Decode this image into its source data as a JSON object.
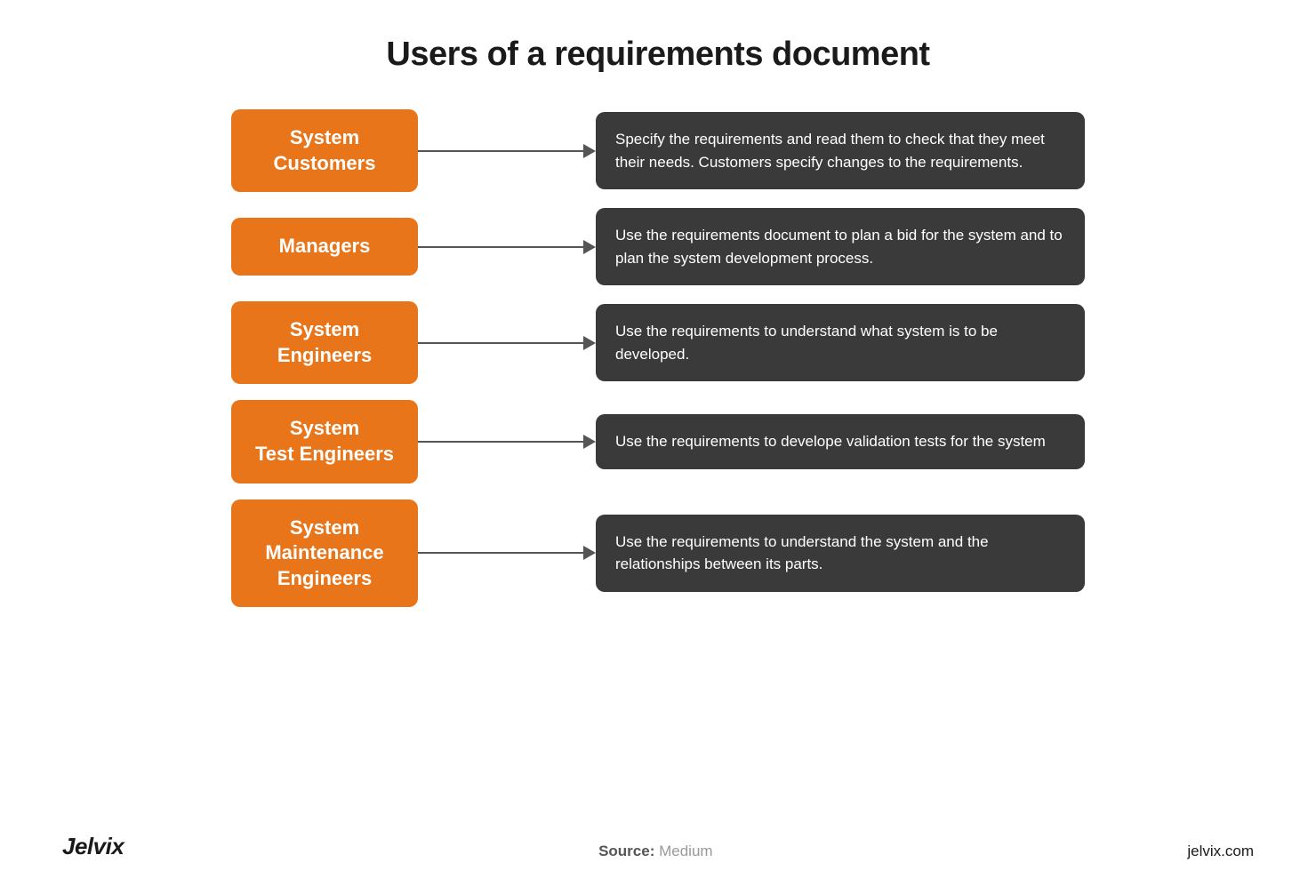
{
  "page": {
    "title": "Users of a requirements document",
    "background_color": "#ffffff"
  },
  "rows": [
    {
      "id": "system-customers",
      "label": "System\nCustomers",
      "description": "Specify the requirements and read them to check that they meet their needs. Customers specify changes to the requirements."
    },
    {
      "id": "managers",
      "label": "Managers",
      "description": "Use the requirements document to plan a bid for the system and to plan the system development process."
    },
    {
      "id": "system-engineers",
      "label": "System\nEngineers",
      "description": "Use the requirements to understand what system is to be developed."
    },
    {
      "id": "system-test-engineers",
      "label": "System\nTest Engineers",
      "description": "Use the requirements to develope validation tests for the system"
    },
    {
      "id": "system-maintenance-engineers",
      "label": "System\nMaintenance\nEngineers",
      "description": "Use the requirements to understand the system and the relationships between its parts."
    }
  ],
  "footer": {
    "brand_left": "Jelvix",
    "brand_dot": "·",
    "source_label": "Source:",
    "source_value": "Medium",
    "brand_right": "jelvix.com"
  },
  "colors": {
    "label_bg": "#e8751a",
    "desc_bg": "#3a3a3a",
    "arrow_color": "#555555",
    "title_color": "#1a1a1a"
  }
}
